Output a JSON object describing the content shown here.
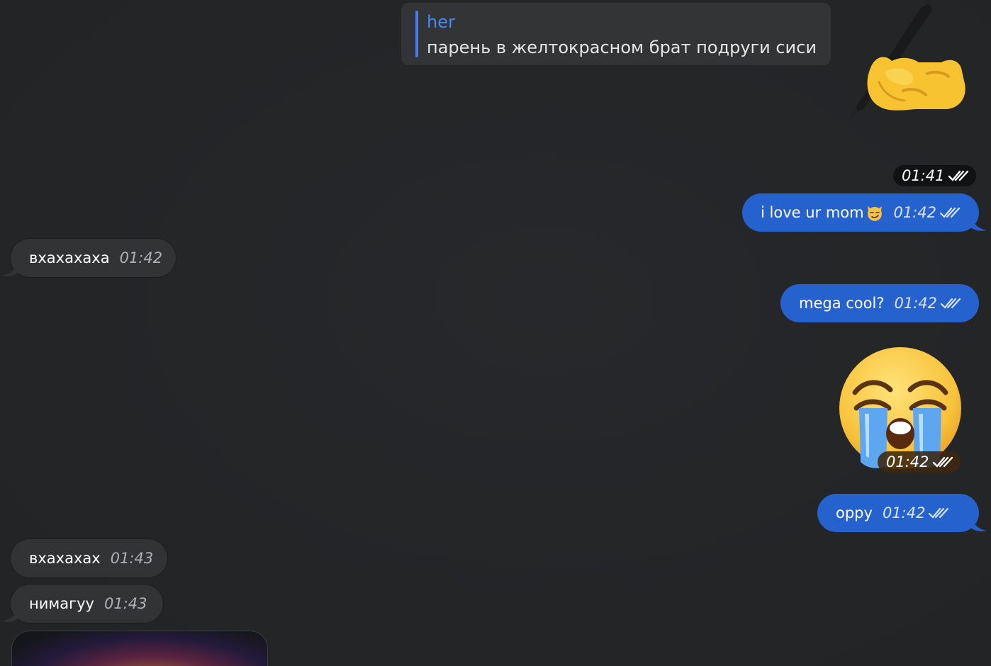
{
  "reply_card": {
    "author": "her",
    "text": "парень в желтокрасном брат подруги сиси"
  },
  "messages": [
    {
      "id": "sticker-writing-hand",
      "type": "sticker",
      "icon": "writing-hand-icon",
      "time": "01:41",
      "status": "read"
    },
    {
      "id": "msg-love",
      "type": "outgoing",
      "text": "i love ur mom",
      "emoji_icon": "smirking-cat-icon",
      "time": "01:42",
      "status": "read"
    },
    {
      "id": "msg-vhaha",
      "type": "incoming",
      "text": "вхахахаха",
      "time": "01:42"
    },
    {
      "id": "msg-mega",
      "type": "outgoing",
      "text": "mega cool?",
      "time": "01:42",
      "status": "read"
    },
    {
      "id": "sticker-crying",
      "type": "sticker",
      "icon": "loudly-crying-face-icon",
      "time": "01:42",
      "status": "read"
    },
    {
      "id": "msg-oppy",
      "type": "outgoing",
      "text": "орру",
      "time": "01:42",
      "status": "read"
    },
    {
      "id": "msg-vhahah",
      "type": "incoming",
      "text": "вхахахах",
      "time": "01:43"
    },
    {
      "id": "msg-nimaguu",
      "type": "incoming",
      "text": "нимагуу",
      "time": "01:43"
    },
    {
      "id": "media-preview",
      "type": "incoming-media",
      "icon": "image-thumbnail"
    }
  ],
  "colors": {
    "background": "#242628",
    "outgoing_bubble": "#2562cd",
    "incoming_bubble": "#313335",
    "reply_accent": "#3f7df0"
  }
}
